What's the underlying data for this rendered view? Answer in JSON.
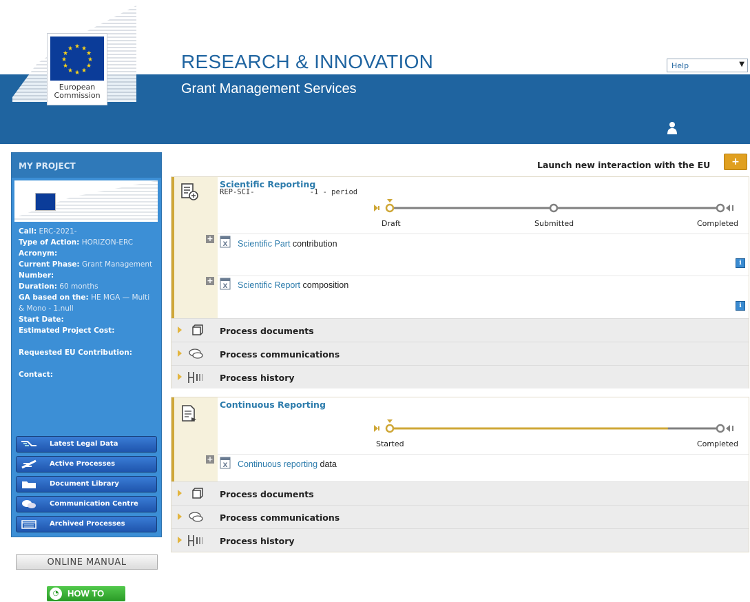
{
  "header": {
    "logo_text": "European Commission",
    "app_title": "RESEARCH & INNOVATION",
    "app_subtitle": "Grant Management Services",
    "help_select": "Help"
  },
  "sidebar": {
    "title": "MY PROJECT",
    "fields": [
      {
        "label": "Call:",
        "value": "ERC-2021-"
      },
      {
        "label": "Type of Action:",
        "value": "HORIZON-ERC"
      },
      {
        "label": "Acronym:",
        "value": ""
      },
      {
        "label": "Current Phase:",
        "value": "Grant Management"
      },
      {
        "label": "Number:",
        "value": ""
      },
      {
        "label": "Duration:",
        "value": "60 months"
      },
      {
        "label": "GA based on the:",
        "value": "HE MGA — Multi & Mono - 1.null"
      },
      {
        "label": "Start Date:",
        "value": ""
      },
      {
        "label": "Estimated Project Cost:",
        "value": ""
      },
      {
        "label": "Requested EU Contribution:",
        "value": ""
      },
      {
        "label": "Contact:",
        "value": ""
      }
    ],
    "nav": [
      {
        "label": "Latest Legal Data",
        "icon": "legal-data-icon"
      },
      {
        "label": "Active Processes",
        "icon": "active-processes-icon"
      },
      {
        "label": "Document Library",
        "icon": "folder-icon"
      },
      {
        "label": "Communication Centre",
        "icon": "chat-icon"
      },
      {
        "label": "Archived Processes",
        "icon": "archive-icon"
      }
    ],
    "online_manual": "ONLINE MANUAL",
    "how_to": "HOW TO"
  },
  "main": {
    "launch_label": "Launch new interaction with the EU",
    "launch_button": "+",
    "process1": {
      "title": "Scientific Reporting",
      "ref_prefix": "REP-SCI-",
      "ref_suffix": "-1 - period",
      "steps": [
        "Draft",
        "Submitted",
        "Completed"
      ],
      "progress": 0,
      "actions": [
        {
          "link": "Scientific Part",
          "text": " contribution"
        },
        {
          "link": "Scientific Report",
          "text": " composition"
        }
      ],
      "rows": [
        "Process documents",
        "Process communications",
        "Process history"
      ]
    },
    "process2": {
      "title": "Continuous Reporting",
      "steps": [
        "Started",
        "Completed"
      ],
      "progress": 0.85,
      "actions": [
        {
          "link": "Continuous reporting",
          "text": " data"
        }
      ],
      "rows": [
        "Process documents",
        "Process communications",
        "Process history"
      ]
    }
  },
  "colors": {
    "brand_blue": "#1f64a0",
    "sidebar_blue": "#3c8fd6",
    "accent_gold": "#cfa737",
    "link": "#2d7cac"
  }
}
